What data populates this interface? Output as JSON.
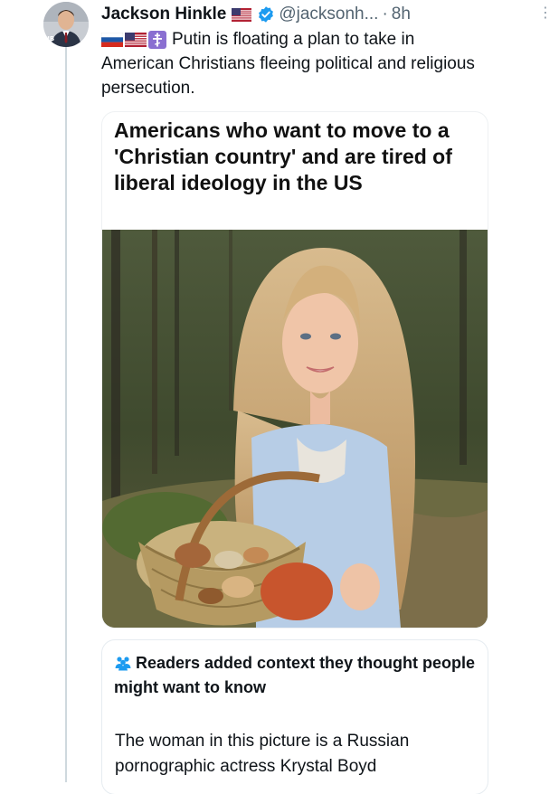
{
  "tweet": {
    "author_name": "Jackson Hinkle",
    "handle": "@jacksonh...",
    "separator": "·",
    "time": "8h",
    "text": "Putin is floating a plan to take in American Christians fleeing political and religious persecution.",
    "emoji": [
      "russia-flag",
      "usa-flag",
      "orthodox-cross"
    ]
  },
  "card": {
    "headline": "Americans who want to move to a 'Christian country' and are tired of liberal ideology in the US",
    "image": "woman-holding-mushroom-basket-in-forest"
  },
  "community_note": {
    "header": "Readers added context they thought people might want to know",
    "text": "The woman in this picture is a Russian pornographic actress Krystal Boyd"
  },
  "colors": {
    "text": "#0f1419",
    "secondary": "#536471",
    "verified": "#1d9bf0",
    "note_icon": "#1d9bf0",
    "thread_line": "#cfd9de"
  }
}
